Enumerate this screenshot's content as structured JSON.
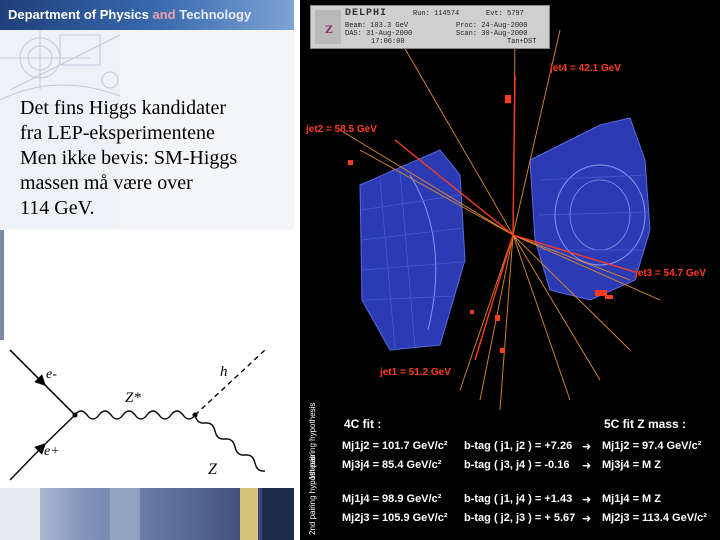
{
  "header": {
    "title_part1": "Department of Physics",
    "title_and": " and ",
    "title_part2": "Technology"
  },
  "slide_text": {
    "lines": [
      "Det fins Higgs kandidater",
      "fra LEP-eksperimentene",
      "Men ikke bevis: SM-Higgs",
      "massen må være over",
      "114 GeV."
    ]
  },
  "feynman": {
    "e_minus": "e-",
    "e_plus": "e+",
    "z_star": "Z*",
    "h": "h",
    "z": "Z"
  },
  "event_display": {
    "detector": "DELPHI",
    "run_label": "Run:",
    "run": "114574",
    "evt_label": "Evt:",
    "evt": "5797",
    "beam_label": "Beam:",
    "beam": "103.3 GeV",
    "proc_label": "Proc:",
    "proc": "24-Aug-2000",
    "das_label": "DAS:",
    "das_date": "31-Aug-2000",
    "das_time": "17:06:00",
    "scan_label": "Scan:",
    "scan": "30-Aug-2000",
    "tan": "Tan+DST",
    "jets": {
      "jet1": "jet1 = 51.2 GeV",
      "jet2": "jet2 = 58.5 GeV",
      "jet3": "jet3 = 54.7 GeV",
      "jet4": "jet4 = 42.1 GeV"
    },
    "fit4c_title": "4C fit :",
    "fit5c_title": "5C fit Z mass :",
    "pairing1_label": "1st pairing hypothesis",
    "pairing2_label": "2nd pairing hypothesis",
    "rows": [
      {
        "mass": "Mj1j2 = 101.7 GeV/c²",
        "btag": "b-tag ( j1, j2 ) = +7.26",
        "fit5c": "Mj1j2 = 97.4 GeV/c²"
      },
      {
        "mass": "Mj3j4 = 85.4 GeV/c²",
        "btag": "b-tag ( j3, j4 ) = -0.16",
        "fit5c": "Mj3j4 = M Z"
      },
      {
        "mass": "Mj1j4 = 98.9 GeV/c²",
        "btag": "b-tag ( j1, j4 ) = +1.43",
        "fit5c": "Mj1j4 = M Z"
      },
      {
        "mass": "Mj2j3 = 105.9 GeV/c²",
        "btag": "b-tag ( j2, j3 ) = + 5.67",
        "fit5c": "Mj2j3 = 113.4 GeV/c²"
      }
    ],
    "arrow": "➜"
  },
  "colors": {
    "header_blue": "#2a4f8f",
    "detector_blue": "#2b3bb3",
    "jet_red": "#ff3b1f",
    "track_orange": "#e08a2e"
  }
}
